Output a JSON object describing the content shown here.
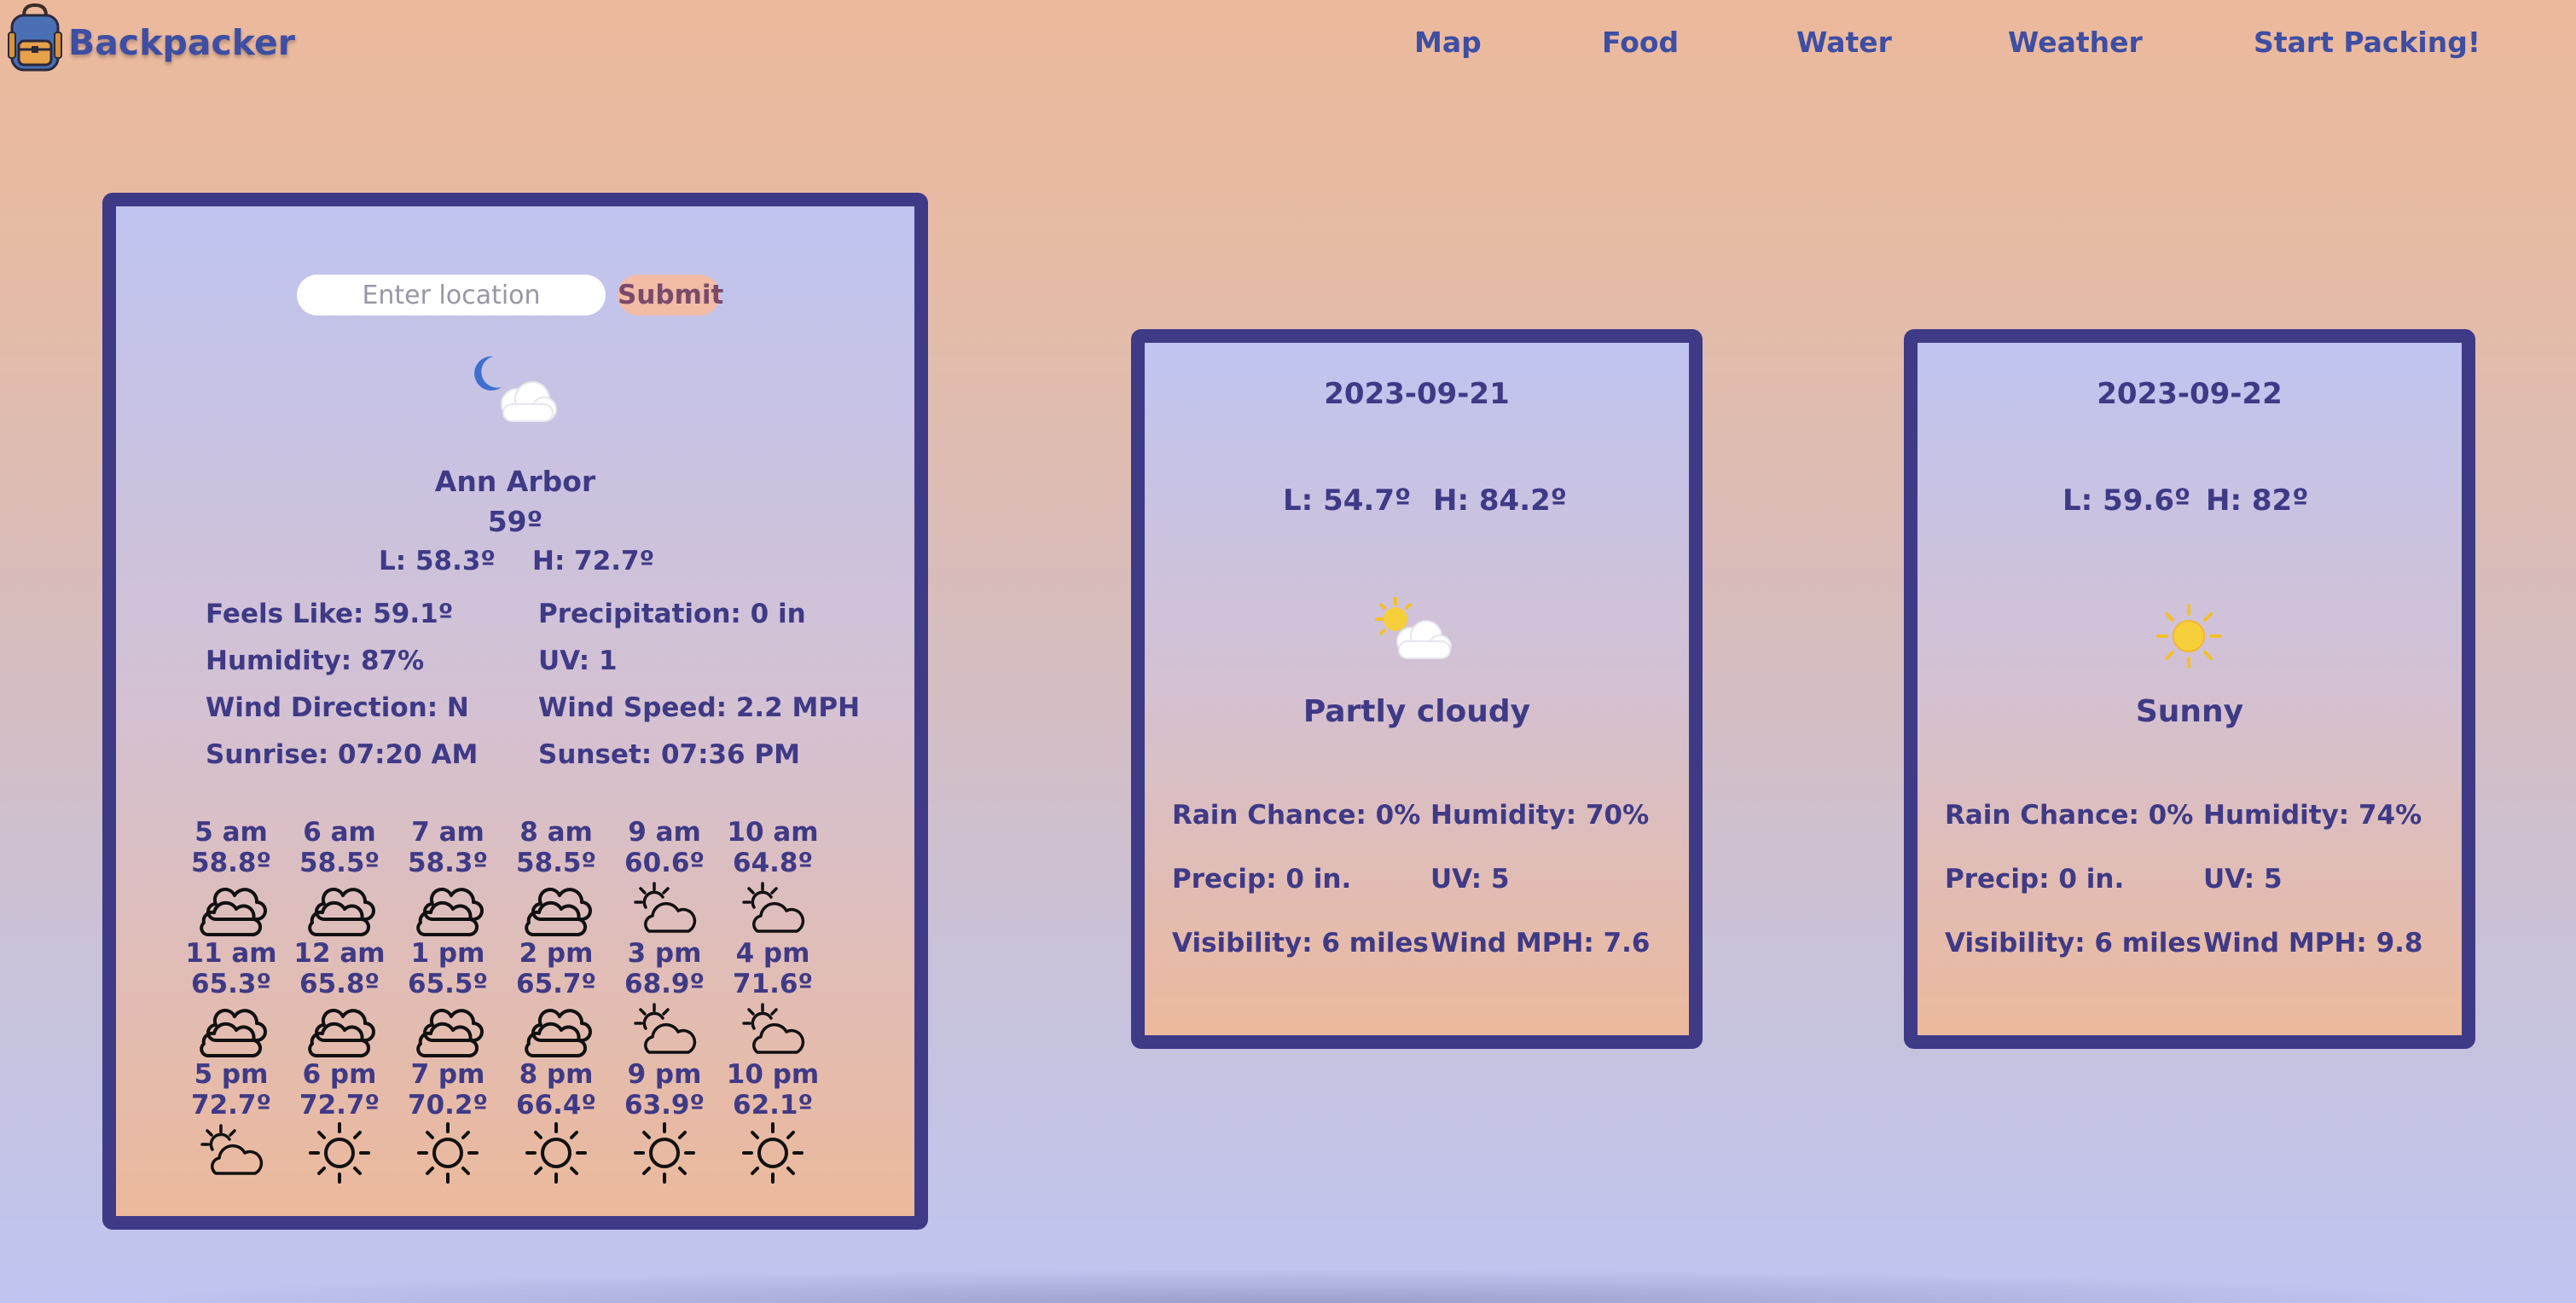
{
  "nav": {
    "brand": "Backpacker",
    "links": [
      "Map",
      "Food",
      "Water",
      "Weather",
      "Start Packing!"
    ]
  },
  "current": {
    "search_placeholder": "Enter location",
    "submit_label": "Submit",
    "condition_icon": "night-cloudy-icon",
    "location": "Ann Arbor",
    "temp": "59º",
    "low": "L: 58.3º",
    "high": "H: 72.7º",
    "details": [
      "Feels Like: 59.1º",
      "Precipitation: 0 in",
      "Humidity: 87%",
      "UV: 1",
      "Wind Direction: N",
      "Wind Speed: 2.2 MPH",
      "Sunrise: 07:20 AM",
      "Sunset: 07:36 PM"
    ],
    "hourly": [
      {
        "time": "5 am",
        "temp": "58.8º",
        "icon": "cloudy-icon"
      },
      {
        "time": "6 am",
        "temp": "58.5º",
        "icon": "cloudy-icon"
      },
      {
        "time": "7 am",
        "temp": "58.3º",
        "icon": "cloudy-icon"
      },
      {
        "time": "8 am",
        "temp": "58.5º",
        "icon": "cloudy-icon"
      },
      {
        "time": "9 am",
        "temp": "60.6º",
        "icon": "partly-cloudy-icon"
      },
      {
        "time": "10 am",
        "temp": "64.8º",
        "icon": "partly-cloudy-icon"
      },
      {
        "time": "11 am",
        "temp": "65.3º",
        "icon": "cloudy-icon"
      },
      {
        "time": "12 am",
        "temp": "65.8º",
        "icon": "cloudy-icon"
      },
      {
        "time": "1 pm",
        "temp": "65.5º",
        "icon": "cloudy-icon"
      },
      {
        "time": "2 pm",
        "temp": "65.7º",
        "icon": "cloudy-icon"
      },
      {
        "time": "3 pm",
        "temp": "68.9º",
        "icon": "partly-cloudy-icon"
      },
      {
        "time": "4 pm",
        "temp": "71.6º",
        "icon": "partly-cloudy-icon"
      },
      {
        "time": "5 pm",
        "temp": "72.7º",
        "icon": "partly-cloudy-icon"
      },
      {
        "time": "6 pm",
        "temp": "72.7º",
        "icon": "sun-icon"
      },
      {
        "time": "7 pm",
        "temp": "70.2º",
        "icon": "sun-icon"
      },
      {
        "time": "8 pm",
        "temp": "66.4º",
        "icon": "sun-icon"
      },
      {
        "time": "9 pm",
        "temp": "63.9º",
        "icon": "sun-icon"
      },
      {
        "time": "10 pm",
        "temp": "62.1º",
        "icon": "sun-icon"
      }
    ]
  },
  "forecast": [
    {
      "date": "2023-09-21",
      "low": "L: 54.7º",
      "high": "H: 84.2º",
      "icon": "partly-cloudy-day-icon",
      "condition": "Partly cloudy",
      "details": [
        "Rain Chance: 0%",
        "Humidity: 70%",
        "Precip: 0 in.",
        "UV: 5",
        "Visibility: 6 miles",
        "Wind MPH: 7.6"
      ]
    },
    {
      "date": "2023-09-22",
      "low": "L: 59.6º",
      "high": "H: 82º",
      "icon": "sunny-icon",
      "condition": "Sunny",
      "details": [
        "Rain Chance: 0%",
        "Humidity: 74%",
        "Precip: 0 in.",
        "UV: 5",
        "Visibility: 6 miles",
        "Wind MPH: 9.8"
      ]
    }
  ],
  "colors": {
    "accent": "#3f3a86",
    "link": "#3d4ea3",
    "background_top": "#ecb99c",
    "background_bottom": "#bfc4f0"
  }
}
